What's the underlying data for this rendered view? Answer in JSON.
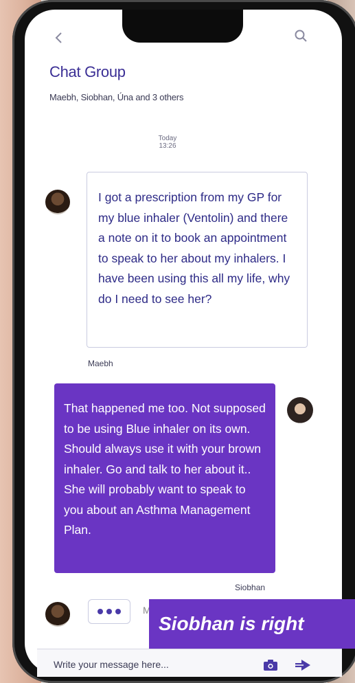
{
  "header": {
    "title": "Chat Group",
    "members": "Maebh, Siobhan, Úna and 3 others",
    "back_icon": "chevron-left-icon",
    "search_icon": "search-icon"
  },
  "timestamp": {
    "day": "Today",
    "time": "13:26"
  },
  "messages": [
    {
      "sender": "Maebh",
      "text": "I got a prescription from my GP for my blue inhaler (Ventolin) and there a note on it to book an appointment to speak to her about my inhalers. I have been using this all my life, why do I need to see her?"
    },
    {
      "sender": "Siobhan",
      "text": "That happened me too. Not supposed to be using Blue inhaler on its own. Should always use it with your brown inhaler. Go and talk to her about it.. She will probably want to speak to you about an Asthma Management Plan."
    }
  ],
  "typing_preview": "M",
  "caption": "Siobhan is right",
  "composer": {
    "placeholder": "Write your message here...",
    "camera_icon": "camera-icon",
    "send_icon": "send-icon"
  },
  "colors": {
    "accent": "#6a35c3",
    "title": "#3b2f95",
    "incoming_text": "#2d2a86"
  }
}
